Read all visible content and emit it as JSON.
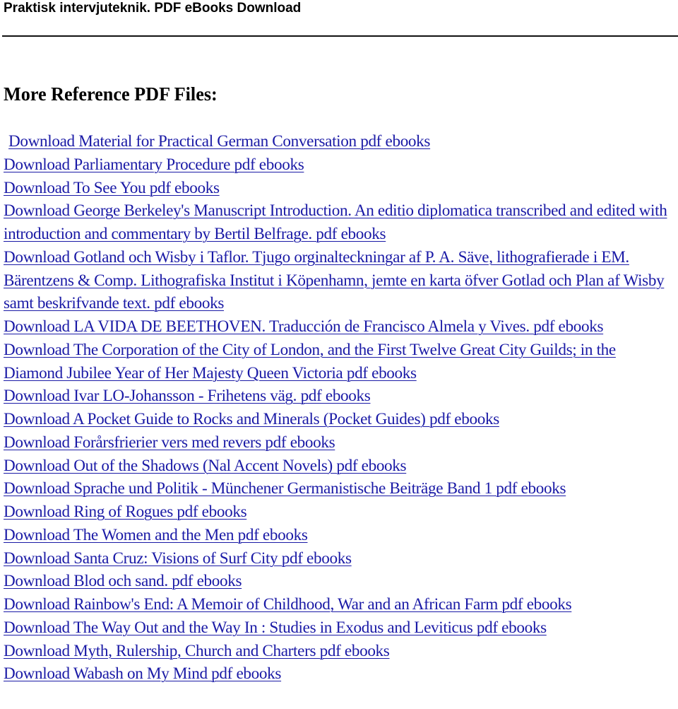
{
  "header": {
    "title": "Praktisk intervjuteknik. PDF eBooks Download"
  },
  "section": {
    "title": "More Reference PDF Files:"
  },
  "links": [
    "Download Material for Practical German Conversation pdf ebooks",
    "Download Parliamentary Procedure pdf ebooks",
    "Download To See You pdf ebooks",
    "Download George Berkeley's Manuscript Introduction. An editio diplomatica transcribed and edited with introduction and commentary by Bertil Belfrage. pdf ebooks",
    "Download Gotland och Wisby i Taflor. Tjugo orginalteckningar af P. A. Säve, lithografierade i EM. Bärentzens & Comp. Lithografiska Institut i Köpenhamn, jemte en karta öfver Gotlad och Plan af Wisby samt beskrifvande text. pdf ebooks",
    "Download LA VIDA DE BEETHOVEN. Traducción de Francisco Almela y Vives. pdf ebooks",
    "Download The Corporation of the City of London, and the First Twelve Great City Guilds; in the Diamond Jubilee Year of Her Majesty Queen Victoria pdf ebooks",
    "Download Ivar LO-Johansson - Frihetens väg. pdf ebooks",
    "Download A Pocket Guide to Rocks and Minerals (Pocket Guides) pdf ebooks",
    "Download Forårsfrierier vers med revers pdf ebooks",
    "Download Out of the Shadows (Nal Accent Novels) pdf ebooks",
    "Download Sprache und Politik - Münchener Germanistische Beiträge Band 1 pdf ebooks",
    "Download Ring of Rogues pdf ebooks",
    "Download The Women and the Men pdf ebooks",
    "Download Santa Cruz: Visions of Surf City pdf ebooks",
    "Download Blod och sand. pdf ebooks",
    "Download Rainbow's End: A Memoir of Childhood, War and an African Farm pdf ebooks",
    "Download The Way Out and the Way In : Studies in Exodus and Leviticus pdf ebooks",
    "Download Myth, Rulership, Church and Charters pdf ebooks",
    "Download Wabash on My Mind pdf ebooks"
  ],
  "colors": {
    "link": "#1a1aa6",
    "text": "#000000",
    "background": "#ffffff"
  }
}
